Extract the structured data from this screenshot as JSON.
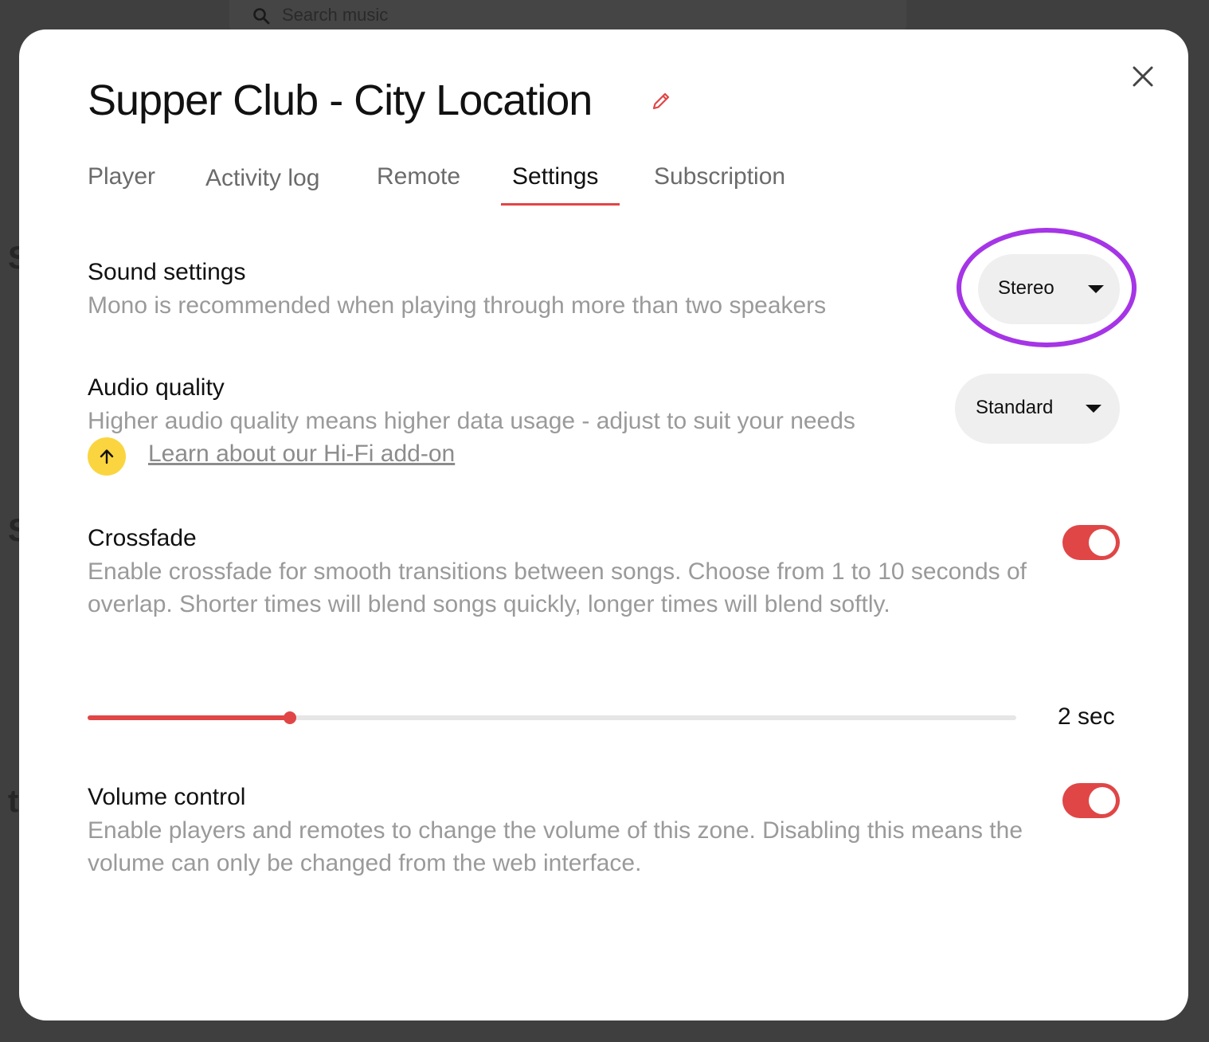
{
  "background": {
    "search_placeholder": "Search music"
  },
  "modal": {
    "title": "Supper Club - City Location",
    "tabs": [
      {
        "label": "Player"
      },
      {
        "label": "Activity log"
      },
      {
        "label": "Remote"
      },
      {
        "label": "Settings"
      },
      {
        "label": "Subscription"
      }
    ],
    "active_tab": "Settings",
    "sound_settings": {
      "title": "Sound settings",
      "description": "Mono is recommended when playing through more than two speakers",
      "selected": "Stereo"
    },
    "audio_quality": {
      "title": "Audio quality",
      "description": "Higher audio quality means higher data usage - adjust to suit your needs",
      "selected": "Standard",
      "link": "Learn about our Hi-Fi add-on"
    },
    "crossfade": {
      "title": "Crossfade",
      "description": "Enable crossfade for smooth transitions between songs. Choose from 1 to 10 seconds of overlap. Shorter times will blend songs quickly, longer times will blend softly.",
      "enabled": true,
      "value_label": "2 sec",
      "value": 2,
      "min": 1,
      "max": 10
    },
    "volume_control": {
      "title": "Volume control",
      "description": "Enable players and remotes to change the volume of this zone. Disabling this means the volume can only be changed from the web interface.",
      "enabled": true
    }
  },
  "colors": {
    "accent": "#e04646",
    "highlight_ring": "#a535e6",
    "upgrade_badge": "#fbd53f"
  }
}
